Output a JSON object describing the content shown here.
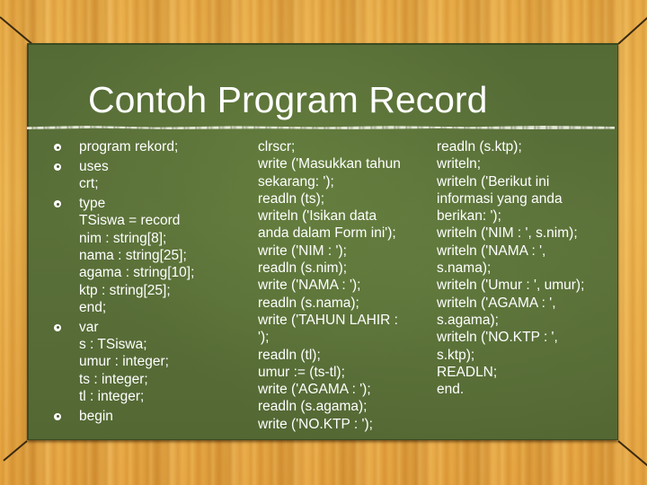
{
  "slide": {
    "title": "Contoh Program Record",
    "colors": {
      "board": "#5a7039",
      "frame": "#e7aa45",
      "text": "#ffffff"
    },
    "column_1": {
      "bullet_icon": "gear-bullet-icon",
      "paragraphs": [
        {
          "lines": [
            "program rekord;"
          ]
        },
        {
          "lines": [
            "uses",
            "crt;"
          ]
        },
        {
          "lines": [
            "type",
            "TSiswa = record",
            "nim : string[8];",
            "nama : string[25];",
            "agama : string[10];",
            "ktp : string[25];",
            "end;"
          ]
        },
        {
          "lines": [
            "var",
            "s : TSiswa;",
            "umur : integer;",
            "ts : integer;",
            "tl : integer;"
          ]
        },
        {
          "lines": [
            "begin"
          ]
        }
      ]
    },
    "column_2": {
      "lines": [
        "clrscr;",
        "write ('Masukkan tahun",
        "sekarang: ');",
        "readln (ts);",
        "writeln ('Isikan data",
        "anda dalam Form ini');",
        "write ('NIM : ');",
        "readln (s.nim);",
        "write ('NAMA : ');",
        "readln (s.nama);",
        "write ('TAHUN LAHIR :",
        "');",
        "readln (tl);",
        "umur := (ts-tl);",
        "write ('AGAMA : ');",
        "readln (s.agama);",
        "write ('NO.KTP : ');"
      ]
    },
    "column_3": {
      "lines": [
        "readln (s.ktp);",
        "writeln;",
        "writeln ('Berikut ini",
        "informasi yang anda",
        "berikan: ');",
        "writeln ('NIM : ', s.nim);",
        "writeln ('NAMA : ',",
        "s.nama);",
        "writeln ('Umur : ', umur);",
        "writeln ('AGAMA : ',",
        "s.agama);",
        "writeln ('NO.KTP : ',",
        "s.ktp);",
        "READLN;",
        "end."
      ]
    }
  }
}
